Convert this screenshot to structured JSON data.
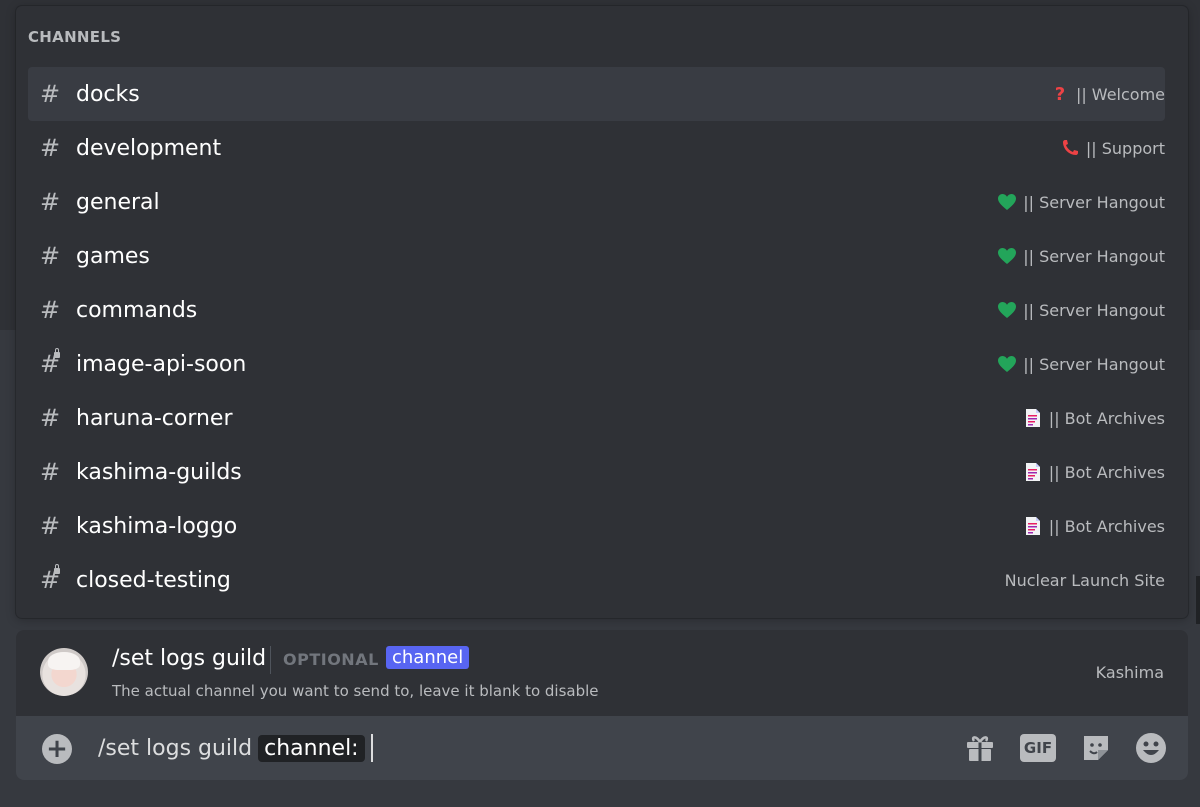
{
  "popup": {
    "header": "CHANNELS",
    "channels": [
      {
        "name": "docks",
        "category": "|| Welcome",
        "icon": "question-mark-icon",
        "locked": false,
        "selected": true
      },
      {
        "name": "development",
        "category": "|| Support",
        "icon": "phone-icon",
        "locked": false,
        "selected": false
      },
      {
        "name": "general",
        "category": "|| Server Hangout",
        "icon": "green-heart-icon",
        "locked": false,
        "selected": false
      },
      {
        "name": "games",
        "category": "|| Server Hangout",
        "icon": "green-heart-icon",
        "locked": false,
        "selected": false
      },
      {
        "name": "commands",
        "category": "|| Server Hangout",
        "icon": "green-heart-icon",
        "locked": false,
        "selected": false
      },
      {
        "name": "image-api-soon",
        "category": "|| Server Hangout",
        "icon": "green-heart-icon",
        "locked": true,
        "selected": false
      },
      {
        "name": "haruna-corner",
        "category": "|| Bot Archives",
        "icon": "document-icon",
        "locked": false,
        "selected": false
      },
      {
        "name": "kashima-guilds",
        "category": "|| Bot Archives",
        "icon": "document-icon",
        "locked": false,
        "selected": false
      },
      {
        "name": "kashima-loggo",
        "category": "|| Bot Archives",
        "icon": "document-icon",
        "locked": false,
        "selected": false
      },
      {
        "name": "closed-testing",
        "category": "Nuclear Launch Site",
        "icon": "",
        "locked": true,
        "selected": false
      }
    ]
  },
  "command": {
    "title": "/set logs guild",
    "optional_label": "OPTIONAL",
    "param": "channel",
    "description": "The actual channel you want to send to, leave it blank to disable",
    "source": "Kashima"
  },
  "input": {
    "text": "/set logs guild",
    "chip": "channel:"
  },
  "colors": {
    "accent": "#5865f2",
    "heart": "#23a55a",
    "question": "#ed4245",
    "phone": "#ed4245"
  }
}
